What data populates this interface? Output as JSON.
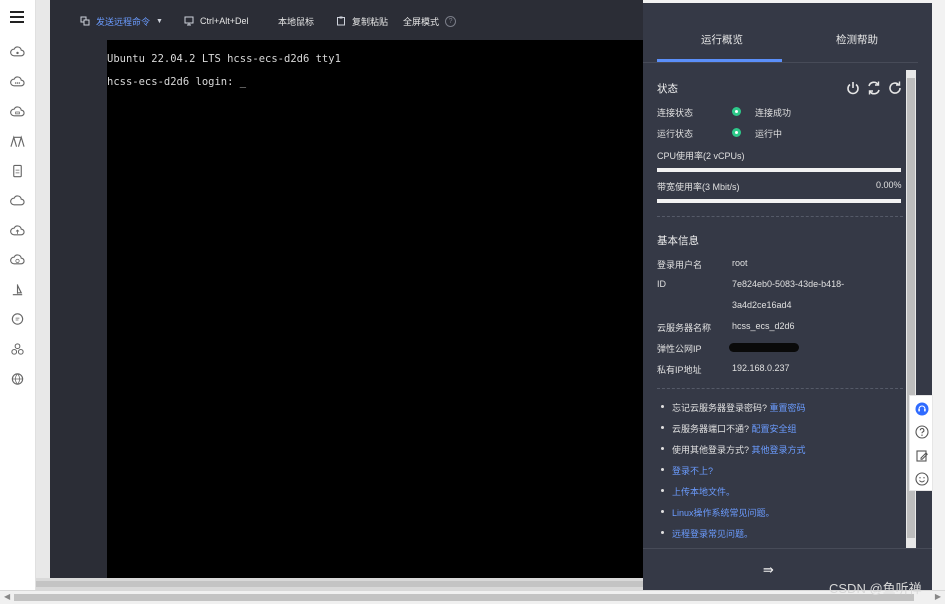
{
  "toolbar": {
    "send_command": "发送远程命令",
    "ctrl_alt_del": "Ctrl+Alt+Del",
    "local_mouse": "本地鼠标",
    "copy_paste": "复制粘贴",
    "fullscreen": "全屏模式",
    "help": "?"
  },
  "terminal": {
    "line1": "Ubuntu 22.04.2 LTS hcss-ecs-d2d6 tty1",
    "line2": "hcss-ecs-d2d6 login: _"
  },
  "panel": {
    "tabs": [
      "运行概览",
      "检测帮助"
    ],
    "status": {
      "title": "状态",
      "conn_label": "连接状态",
      "conn_value": "连接成功",
      "run_label": "运行状态",
      "run_value": "运行中",
      "cpu_label": "CPU使用率(2 vCPUs)",
      "bw_label": "带宽使用率(3 Mbit/s)",
      "bw_value": "0.00%"
    },
    "basic": {
      "title": "基本信息",
      "user_label": "登录用户名",
      "user_value": "root",
      "id_label": "ID",
      "id_value_1": "7e824eb0-5083-43de-b418-",
      "id_value_2": "3a4d2ce16ad4",
      "name_label": "云服务器名称",
      "name_value": "hcss_ecs_d2d6",
      "eip_label": "弹性公网IP",
      "private_label": "私有IP地址",
      "private_value": "192.168.0.237"
    },
    "tips": [
      {
        "text": "忘记云服务器登录密码?",
        "link": "重置密码"
      },
      {
        "text": "云服务器端口不通?",
        "link": "配置安全组"
      },
      {
        "text": "使用其他登录方式?",
        "link": "其他登录方式"
      },
      {
        "text": "",
        "link": "登录不上?"
      },
      {
        "text": "",
        "link": "上传本地文件。"
      },
      {
        "text": "",
        "link": "Linux操作系统常见问题。"
      },
      {
        "text": "",
        "link": "远程登录常见问题。"
      }
    ],
    "collapse": "⇛"
  },
  "watermark": "CSDN @鱼听禅",
  "colors": {
    "accent": "#5b8ff9",
    "link": "#6b9cff",
    "status_ok": "#2ec98a",
    "panel_bg": "#353946",
    "toolbar_bg": "#2b2d36"
  }
}
